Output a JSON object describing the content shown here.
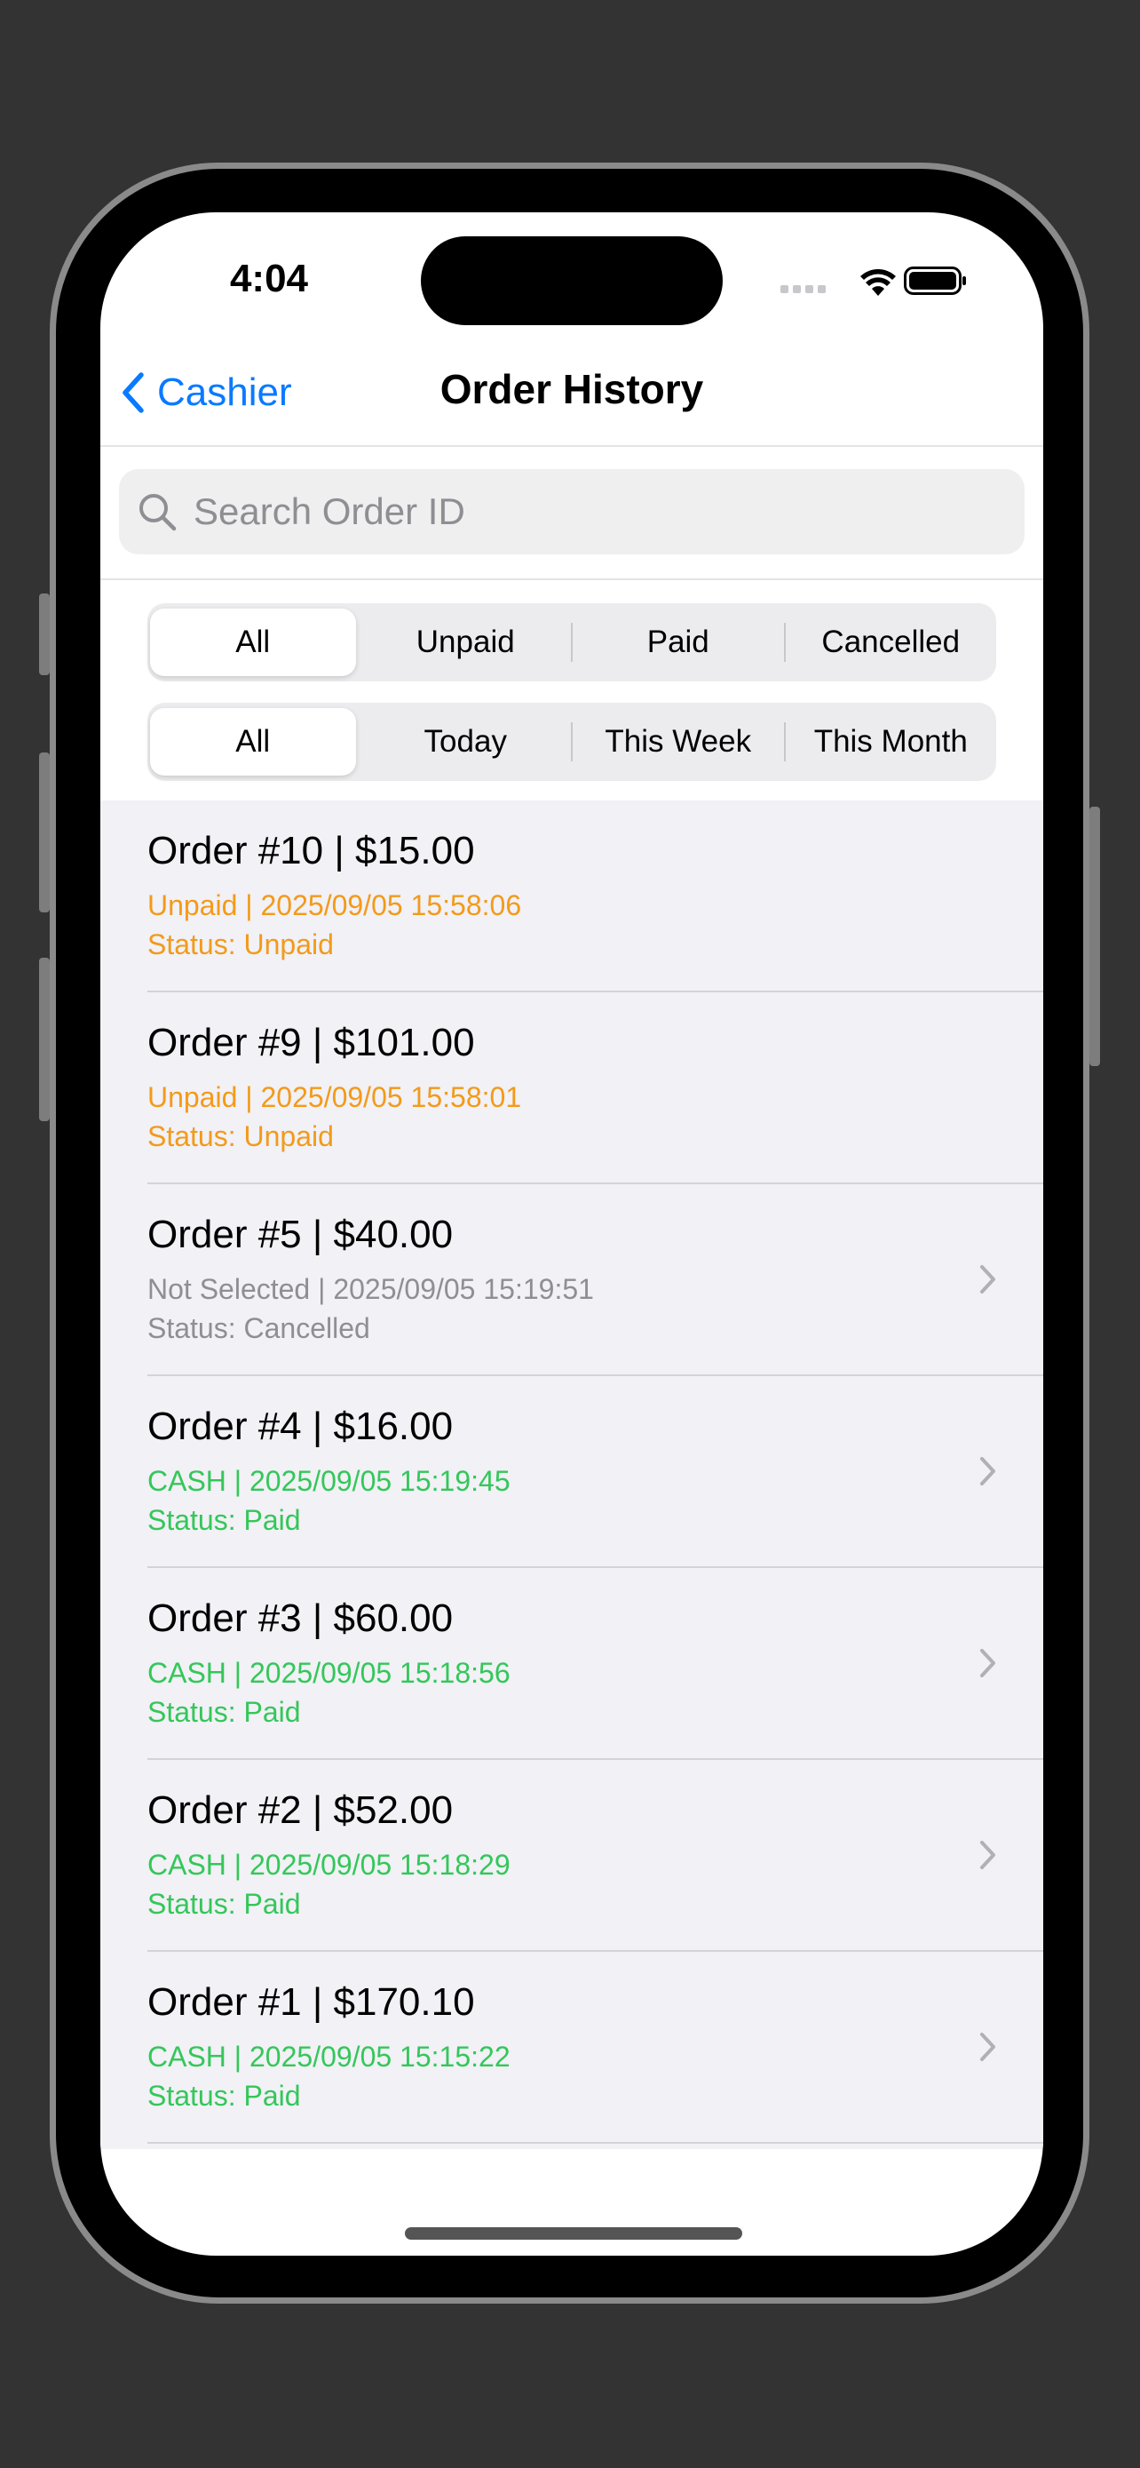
{
  "status_bar": {
    "time": "4:04"
  },
  "nav": {
    "back_label": "Cashier",
    "title": "Order History"
  },
  "search": {
    "placeholder": "Search Order ID",
    "value": ""
  },
  "status_filter": {
    "options": [
      "All",
      "Unpaid",
      "Paid",
      "Cancelled"
    ],
    "selected": "All"
  },
  "date_filter": {
    "options": [
      "All",
      "Today",
      "This Week",
      "This Month"
    ],
    "selected": "All"
  },
  "colors": {
    "accent": "#0a7aff",
    "unpaid": "#f39a1a",
    "paid": "#34c759",
    "cancelled": "#8e8e93"
  },
  "orders": [
    {
      "title": "Order #10 | $15.00",
      "detail": "Unpaid | 2025/09/05 15:58:06",
      "status": "Status: Unpaid",
      "state": "unpaid",
      "has_chevron": false
    },
    {
      "title": "Order #9 | $101.00",
      "detail": "Unpaid | 2025/09/05 15:58:01",
      "status": "Status: Unpaid",
      "state": "unpaid",
      "has_chevron": false
    },
    {
      "title": "Order #5 | $40.00",
      "detail": "Not Selected | 2025/09/05 15:19:51",
      "status": "Status: Cancelled",
      "state": "cancelled",
      "has_chevron": true
    },
    {
      "title": "Order #4 | $16.00",
      "detail": "CASH | 2025/09/05 15:19:45",
      "status": "Status: Paid",
      "state": "paid",
      "has_chevron": true
    },
    {
      "title": "Order #3 | $60.00",
      "detail": "CASH | 2025/09/05 15:18:56",
      "status": "Status: Paid",
      "state": "paid",
      "has_chevron": true
    },
    {
      "title": "Order #2 | $52.00",
      "detail": "CASH | 2025/09/05 15:18:29",
      "status": "Status: Paid",
      "state": "paid",
      "has_chevron": true
    },
    {
      "title": "Order #1 | $170.10",
      "detail": "CASH | 2025/09/05 15:15:22",
      "status": "Status: Paid",
      "state": "paid",
      "has_chevron": true
    }
  ]
}
